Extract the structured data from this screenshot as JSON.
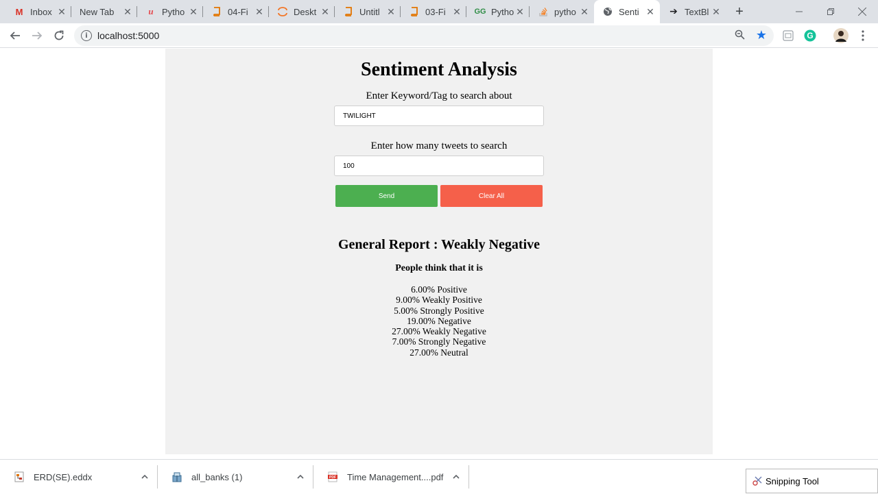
{
  "tabs": [
    {
      "title": "Inbox",
      "icon": "gmail-icon",
      "glyph": "M",
      "color": "#d93025"
    },
    {
      "title": "New Tab",
      "icon": "",
      "glyph": "",
      "color": "#5f6368"
    },
    {
      "title": "Pytho",
      "icon": "udemy-icon",
      "glyph": "u",
      "color": "#e5484d"
    },
    {
      "title": "04-Fi",
      "icon": "book-icon",
      "glyph": "▰",
      "color": "#e37400"
    },
    {
      "title": "Deskt",
      "icon": "jupyter-icon",
      "glyph": "◠",
      "color": "#f37626"
    },
    {
      "title": "Untitl",
      "icon": "book-icon",
      "glyph": "▰",
      "color": "#e37400"
    },
    {
      "title": "03-Fi",
      "icon": "book-icon",
      "glyph": "▰",
      "color": "#e37400"
    },
    {
      "title": "Pytho",
      "icon": "geeksforgeeks-icon",
      "glyph": "GG",
      "color": "#2f8d46"
    },
    {
      "title": "pytho",
      "icon": "stackoverflow-icon",
      "glyph": "≡",
      "color": "#f48024"
    },
    {
      "title": "Senti",
      "icon": "globe-icon",
      "glyph": "◍",
      "color": "#5f6368"
    },
    {
      "title": "TextBl",
      "icon": "arrow-right-icon",
      "glyph": "➔",
      "color": "#202124"
    }
  ],
  "toolbar": {
    "url": "localhost:5000",
    "star_color": "#1a73e8",
    "grammarly_color": "#15c39a"
  },
  "page": {
    "title": "Sentiment Analysis",
    "keyword_label": "Enter Keyword/Tag to search about",
    "keyword_value": "TWILIGHT",
    "count_label": "Enter how many tweets to search",
    "count_value": "100",
    "send_label": "Send",
    "clear_label": "Clear All",
    "send_color": "#4caf50",
    "clear_color": "#f5604a",
    "report_title": "General Report : Weakly Negative",
    "report_subtitle": "People think that it is",
    "stats": [
      {
        "text": "6.00% Positive",
        "percent": 6.0
      },
      {
        "text": "9.00% Weakly Positive",
        "percent": 9.0
      },
      {
        "text": "5.00% Strongly Positive",
        "percent": 5.0
      },
      {
        "text": "19.00% Negative",
        "percent": 19.0
      },
      {
        "text": "27.00% Weakly Negative",
        "percent": 27.0
      },
      {
        "text": "7.00% Strongly Negative",
        "percent": 7.0
      },
      {
        "text": "27.00% Neutral",
        "percent": 27.0
      }
    ]
  },
  "downloads": [
    {
      "name": "ERD(SE).eddx",
      "icon": "eddx-file-icon"
    },
    {
      "name": "all_banks (1)",
      "icon": "archive-file-icon"
    },
    {
      "name": "Time Management....pdf",
      "icon": "pdf-file-icon"
    }
  ],
  "taskbar_popup": {
    "name": "Snipping Tool",
    "icon": "snipping-tool-icon"
  }
}
